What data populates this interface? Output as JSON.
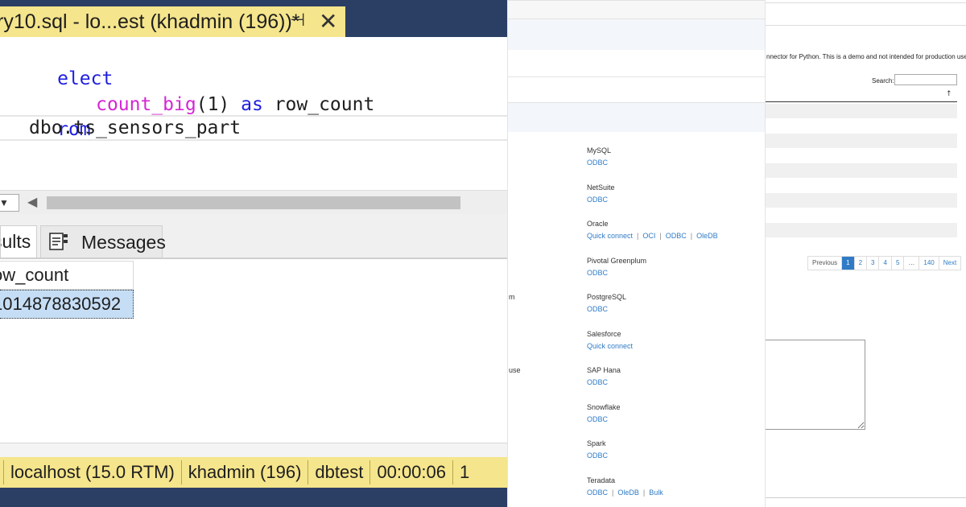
{
  "ssms": {
    "tab_title": "ry10.sql - lo...est (khadmin (196))*",
    "pin_glyph": "⊣",
    "close_glyph": "✕",
    "code": {
      "line1_kw": "elect",
      "line2_fn": "count_big",
      "line2_paren": "(1)",
      "line2_as": "as",
      "line2_alias": "row_count",
      "line3_kw": "rom",
      "line4_table": "dbo.ts_sensors_part"
    },
    "result_tabs": {
      "results": "sults",
      "messages": "Messages"
    },
    "grid": {
      "column": "ow_count",
      "value": "1014878830592"
    },
    "status": {
      "server": "localhost (15.0 RTM)",
      "user": "khadmin (196)",
      "database": "dbtest",
      "elapsed": "00:00:06",
      "rows": "1"
    },
    "colors": {
      "tab_yellow": "#f5e58c",
      "title_navy": "#2b3e64",
      "keyword": "#1f1fe0",
      "function": "#d426d4",
      "selected_cell": "#c6def5"
    }
  },
  "connectors": {
    "fragments": [
      "m",
      "use"
    ],
    "items": [
      {
        "name": "MySQL",
        "links": [
          "ODBC"
        ]
      },
      {
        "name": "NetSuite",
        "links": [
          "ODBC"
        ]
      },
      {
        "name": "Oracle",
        "links": [
          "Quick connect",
          "OCI",
          "ODBC",
          "OleDB"
        ]
      },
      {
        "name": "Pivotal Greenplum",
        "links": [
          "ODBC"
        ]
      },
      {
        "name": "PostgreSQL",
        "links": [
          "ODBC"
        ]
      },
      {
        "name": "Salesforce",
        "links": [
          "Quick connect"
        ]
      },
      {
        "name": "SAP Hana",
        "links": [
          "ODBC"
        ]
      },
      {
        "name": "Snowflake",
        "links": [
          "ODBC"
        ]
      },
      {
        "name": "Spark",
        "links": [
          "ODBC"
        ]
      },
      {
        "name": "Teradata",
        "links": [
          "ODBC",
          "OleDB",
          "Bulk"
        ]
      }
    ],
    "link_color": "#2f7bc6"
  },
  "datatable": {
    "notice": "nnector for Python. This is a demo and not intended for production use.",
    "search_label": "Search:",
    "search_value": "",
    "sort_glyph": "↑",
    "pagination": {
      "previous": "Previous",
      "pages": [
        "1",
        "2",
        "3",
        "4",
        "5",
        "…",
        "140"
      ],
      "active": "1",
      "next": "Next"
    }
  }
}
